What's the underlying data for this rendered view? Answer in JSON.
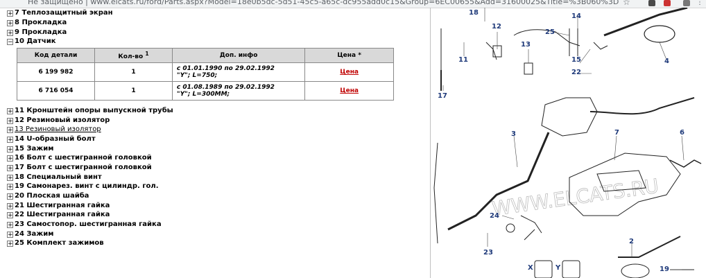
{
  "browser": {
    "security_label": "Не защищено",
    "url": "www.elcats.ru/ford/Parts.aspx?Model=18e0b5dc-5d51-45c5-a65c-dc955add0c15&Group=6EC00655&Add=31600025&Title=%3B060%3D"
  },
  "tree": {
    "items": [
      {
        "sign": "+",
        "label": "7 Теплозащитный экран"
      },
      {
        "sign": "+",
        "label": "8 Прокладка"
      },
      {
        "sign": "+",
        "label": "9 Прокладка"
      },
      {
        "sign": "−",
        "label": "10 Датчик"
      },
      {
        "sign": "+",
        "label": "11 Кронштейн опоры выпускной трубы"
      },
      {
        "sign": "+",
        "label": "12 Резиновый изолятор"
      },
      {
        "sign": "+",
        "label": "13 Резиновый изолятор"
      },
      {
        "sign": "+",
        "label": "14 U-образный болт"
      },
      {
        "sign": "+",
        "label": "15 Зажим"
      },
      {
        "sign": "+",
        "label": "16 Болт с шестигранной головкой"
      },
      {
        "sign": "+",
        "label": "17 Болт с шестигранной головкой"
      },
      {
        "sign": "+",
        "label": "18 Специальный винт"
      },
      {
        "sign": "+",
        "label": "19 Самонарез. винт с цилиндр. гол."
      },
      {
        "sign": "+",
        "label": "20 Плоская шайба"
      },
      {
        "sign": "+",
        "label": "21 Шестигранная гайка"
      },
      {
        "sign": "+",
        "label": "22 Шестигранная гайка"
      },
      {
        "sign": "+",
        "label": "23 Самостопор. шестигранная гайка"
      },
      {
        "sign": "+",
        "label": "24 Зажим"
      },
      {
        "sign": "+",
        "label": "25 Комплект зажимов"
      }
    ]
  },
  "table": {
    "headers": [
      "Код детали",
      "Кол-во",
      "Доп. инфо",
      "Цена *"
    ],
    "qty_sup": "1",
    "rows": [
      {
        "code": "6 199 982",
        "qty": "1",
        "info1": "с 01.01.1990 по 29.02.1992",
        "info2": "\"Y\"; L=750;",
        "price": "Цена"
      },
      {
        "code": "6 716 054",
        "qty": "1",
        "info1": "с 01.08.1989 по 29.02.1992",
        "info2": "\"Y\"; L=300MM;",
        "price": "Цена"
      }
    ]
  },
  "diagram": {
    "callouts": [
      "18",
      "12",
      "11",
      "17",
      "13",
      "14",
      "25",
      "15",
      "22",
      "4",
      "3",
      "7",
      "6",
      "24",
      "23",
      "2",
      "19",
      "X",
      "Y"
    ],
    "watermark": "WWW.ELCATS.RU"
  },
  "colors": {
    "callout": "#1f3a7a",
    "price_link": "#c00000",
    "header_bg": "#d9d9d9"
  }
}
